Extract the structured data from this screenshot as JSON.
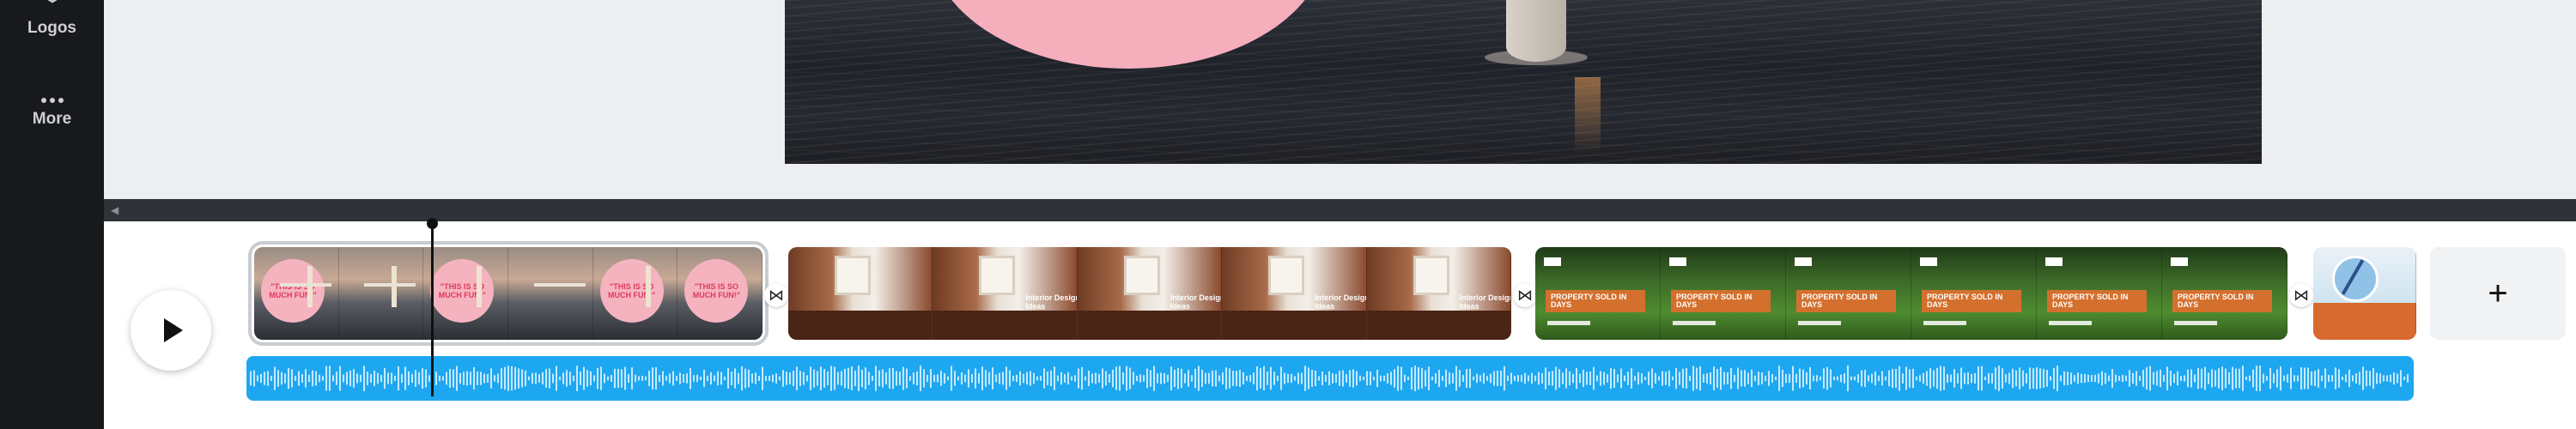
{
  "sidebar": {
    "items": [
      {
        "label": "Logos",
        "icon": "logos-icon"
      },
      {
        "label": "More",
        "icon": "more-dots-icon"
      }
    ]
  },
  "timeline": {
    "scene1": {
      "text": "\"THIS IS SO MUCH FUN!\""
    },
    "scene2": {
      "text": "Interior Design Ideas"
    },
    "scene3": {
      "text": "PROPERTY SOLD IN DAYS"
    },
    "add_page": "+",
    "transition_icon": "⋈"
  },
  "colors": {
    "sidebar_bg": "#18191b",
    "audio_track": "#1ea7f1",
    "pink_accent": "#f4aebc",
    "orange_accent": "#d4702e"
  }
}
